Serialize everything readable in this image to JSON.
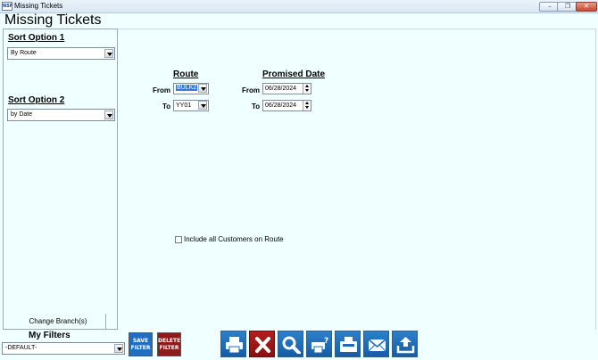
{
  "window": {
    "title": "Missing Tickets",
    "icon_text": "NSF",
    "minimize": "minimize-icon",
    "restore": "restore-icon",
    "close": "close-icon"
  },
  "app_title": "Missing Tickets",
  "sidebar": {
    "sort1": {
      "title": "Sort Option 1",
      "value": "By Route"
    },
    "sort2": {
      "title": "Sort Option 2",
      "value": "by Date"
    },
    "change_branch": "Change Branch(s)"
  },
  "route": {
    "heading": "Route",
    "from_label": "From",
    "from_value": "BULK2",
    "to_label": "To",
    "to_value": "YY01"
  },
  "promised": {
    "heading": "Promised Date",
    "from_label": "From",
    "from_value": "06/28/2024",
    "to_label": "To",
    "to_value": "06/28/2024"
  },
  "include_all": {
    "label": "Include all Customers on Route",
    "checked": false
  },
  "filters": {
    "title": "My Filters",
    "value": "-DEFAULT-",
    "save_line1": "SAVE",
    "save_line2": "FILTER",
    "delete_line1": "DELETE",
    "delete_line2": "FILTER"
  },
  "toolbar": [
    "printer-icon",
    "cancel-x-icon",
    "magnifier-icon",
    "print-preview-icon",
    "fax-icon",
    "email-icon",
    "export-upload-icon"
  ],
  "colors": {
    "tool_blue": "#1d6bb6",
    "cancel_red": "#9c1515",
    "save_blue": "#1e6fc4",
    "delete_red": "#8e1a1a",
    "background": "#f0ffff"
  }
}
